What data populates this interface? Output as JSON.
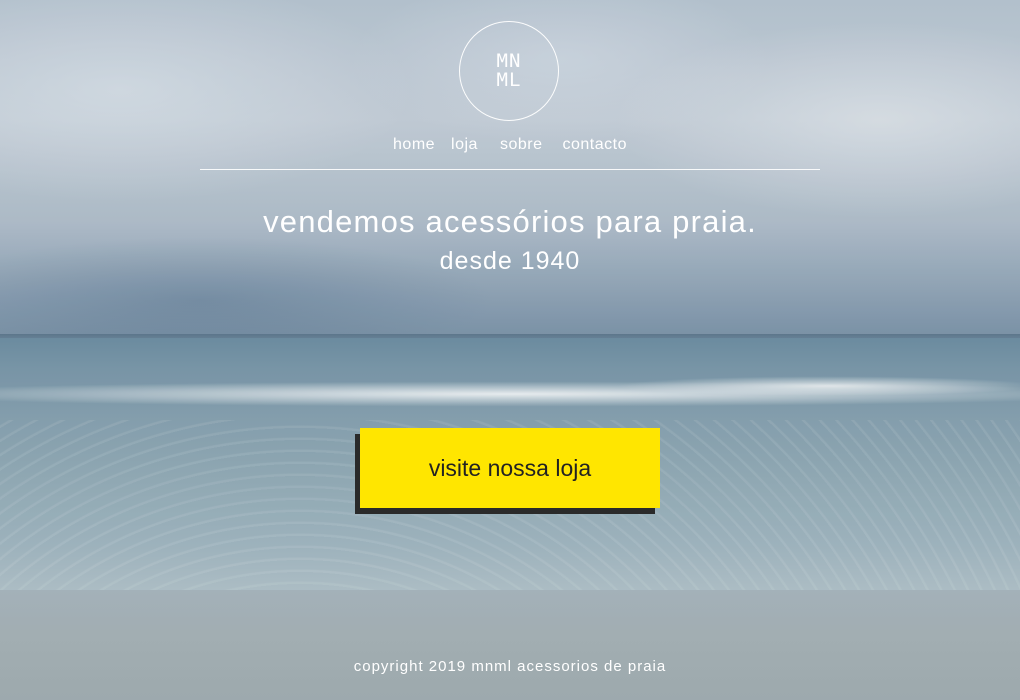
{
  "header": {
    "logo_line1": "MN",
    "logo_line2": "ML",
    "nav": [
      {
        "label": "home"
      },
      {
        "label": "loja"
      },
      {
        "label": "sobre"
      },
      {
        "label": "contacto"
      }
    ]
  },
  "hero": {
    "tagline": "vendemos acessórios para praia.",
    "since": "desde 1940"
  },
  "cta": {
    "label": "visite nossa loja",
    "color": "#ffe600"
  },
  "footer": {
    "copyright": "copyright 2019 mnml acessorios de praia"
  }
}
